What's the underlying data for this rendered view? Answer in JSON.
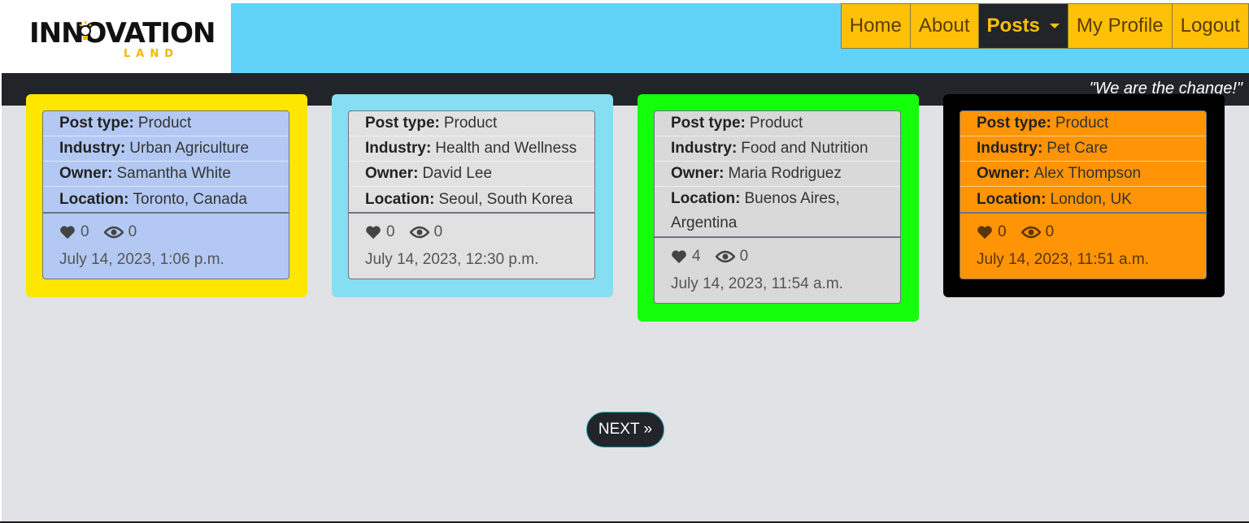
{
  "brand": {
    "logo_main": "INNOVATION",
    "logo_sub": "LAND"
  },
  "nav": {
    "items": [
      {
        "label": "Home"
      },
      {
        "label": "About"
      },
      {
        "label": "Posts"
      },
      {
        "label": "My Profile"
      },
      {
        "label": "Logout"
      }
    ],
    "active": "Posts"
  },
  "slogan": "\"We are the change!\"",
  "field_labels": {
    "post_type": "Post type:",
    "industry": "Industry:",
    "owner": "Owner:",
    "location": "Location:"
  },
  "posts": [
    {
      "post_type": "Product",
      "industry": "Urban Agriculture",
      "owner": "Samantha White",
      "location": "Toronto, Canada",
      "likes": "0",
      "views": "0",
      "date": "July 14, 2023, 1:06 p.m.",
      "frame_color": "#ffe600",
      "inner_color": "#b3c9f4"
    },
    {
      "post_type": "Product",
      "industry": "Health and Wellness",
      "owner": "David Lee",
      "location": "Seoul, South Korea",
      "likes": "0",
      "views": "0",
      "date": "July 14, 2023, 12:30 p.m.",
      "frame_color": "#86def2",
      "inner_color": "#e1e1e1"
    },
    {
      "post_type": "Product",
      "industry": "Food and Nutrition",
      "owner": "Maria Rodriguez",
      "location": "Buenos Aires, Argentina",
      "likes": "4",
      "views": "0",
      "date": "July 14, 2023, 11:54 a.m.",
      "frame_color": "#14ff0a",
      "inner_color": "#d9d9d9"
    },
    {
      "post_type": "Product",
      "industry": "Pet Care",
      "owner": "Alex Thompson",
      "location": "London, UK",
      "likes": "0",
      "views": "0",
      "date": "July 14, 2023, 11:51 a.m.",
      "frame_color": "#000000",
      "inner_color": "#ff9406"
    }
  ],
  "pagination": {
    "next_label": "NEXT »"
  },
  "icons": {
    "like": "heart-icon",
    "views": "eye-icon",
    "dropdown": "caret-down-icon"
  }
}
